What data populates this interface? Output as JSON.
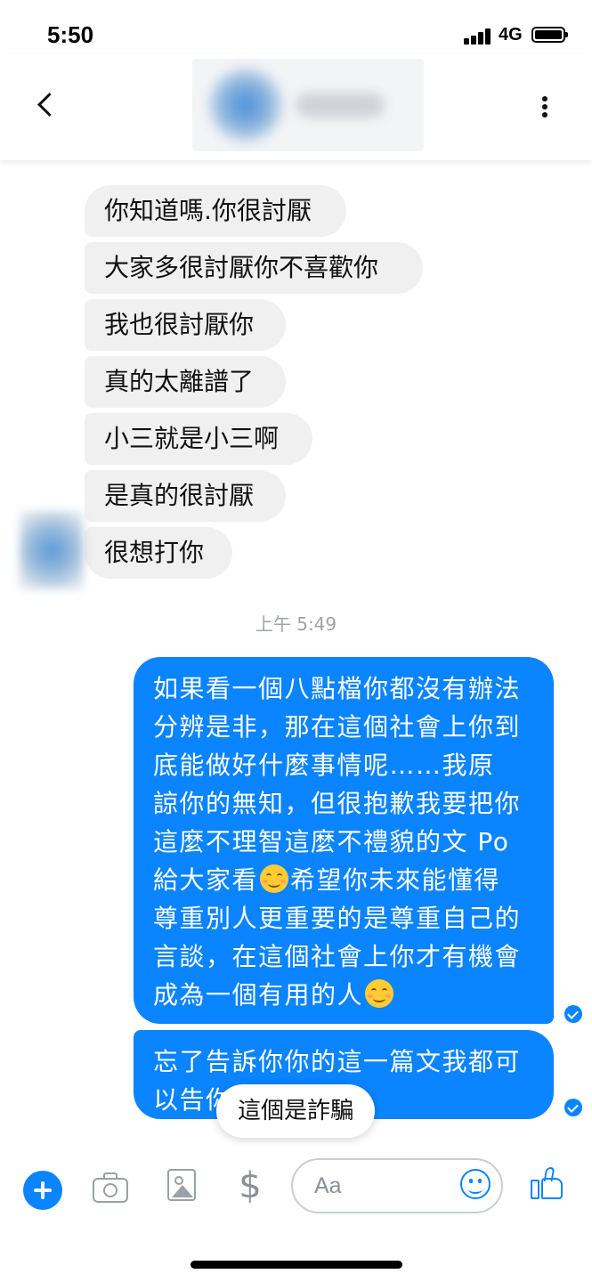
{
  "status_bar": {
    "time": "5:50",
    "network": "4G"
  },
  "header": {
    "back_icon": "chevron-left-icon",
    "more_icon": "vertical-dots-icon",
    "contact_blurred": true
  },
  "incoming_messages": [
    "你知道嗎.你很討厭",
    "大家多很討厭你不喜歡你",
    "我也很討厭你",
    "真的太離譜了",
    "小三就是小三啊",
    "是真的很討厭",
    "很想打你"
  ],
  "timestamp": "上午 5:49",
  "outgoing_messages": [
    {
      "lines": [
        "如果看一個八點檔你都沒有辦法",
        "分辨是非，那在這個社會上你到",
        "底能做好什麼事情呢……我原",
        "諒你的無知，但很抱歉我要把你",
        "這麼不理智這麼不禮貌的文 Po",
        "給大家看",
        "希望你未來能懂得",
        "尊重別人更重要的是尊重自己的",
        "言談，在這個社會上你才有機會",
        "成為一個有用的人"
      ],
      "emoji": "smiling-face-emoji",
      "status": "read"
    },
    {
      "lines": [
        "忘了告訴你你的這一篇文我都可",
        "以告你"
      ],
      "status": "read"
    }
  ],
  "overlay_label": "這個是詐騙",
  "composer": {
    "placeholder": "Aa",
    "icons": [
      "plus-icon",
      "camera-icon",
      "gallery-icon",
      "dollar-icon",
      "smiley-icon",
      "thumbs-up-icon"
    ],
    "accent_color": "#0a84ff"
  },
  "colors": {
    "outgoing_bubble": "#0a84ff",
    "incoming_bubble": "#f1f0f0"
  }
}
